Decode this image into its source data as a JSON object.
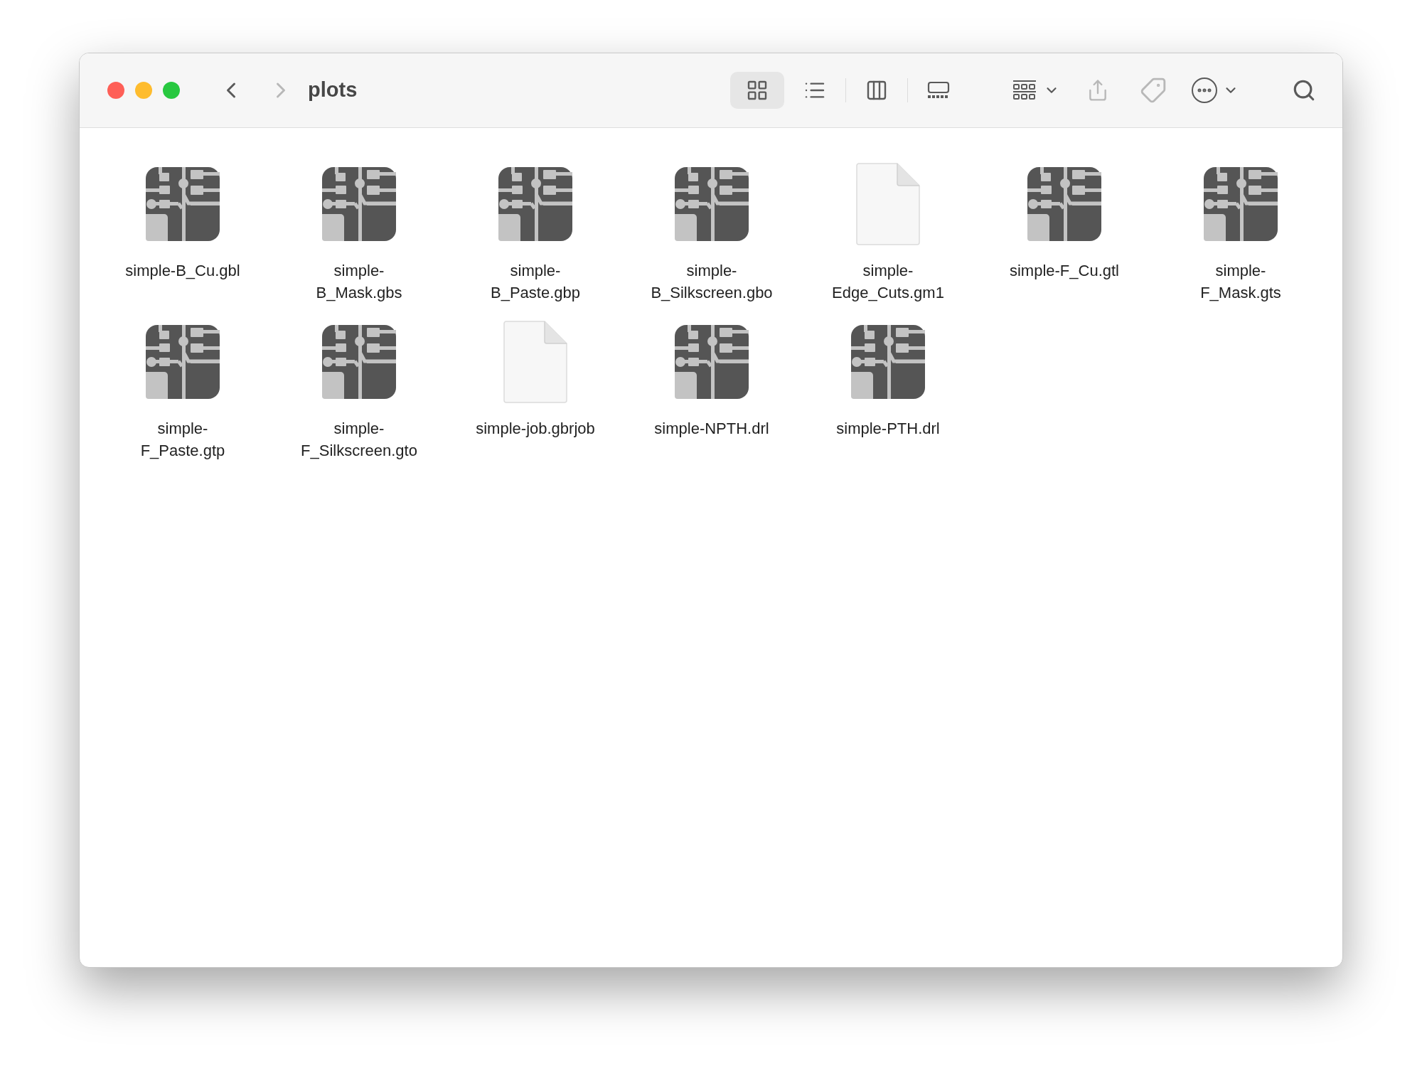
{
  "window": {
    "title": "plots"
  },
  "navigation": [
    {
      "kind": "back",
      "disabled": false
    },
    {
      "kind": "forward",
      "disabled": true
    }
  ],
  "view_buttons": [
    {
      "kind": "icons",
      "selected": true
    },
    {
      "kind": "list",
      "selected": false
    },
    {
      "kind": "columns",
      "selected": false
    },
    {
      "kind": "gallery",
      "selected": false
    }
  ],
  "toolbar_actions": [
    {
      "kind": "group",
      "disabled": false
    },
    {
      "kind": "share",
      "disabled": true
    },
    {
      "kind": "tag",
      "disabled": true
    },
    {
      "kind": "more",
      "disabled": false
    },
    {
      "kind": "search",
      "disabled": false
    }
  ],
  "files": [
    {
      "kind": "pcb",
      "name_lines": [
        "simple-B_Cu.gbl"
      ]
    },
    {
      "kind": "pcb",
      "name_lines": [
        "simple-",
        "B_Mask.gbs"
      ]
    },
    {
      "kind": "pcb",
      "name_lines": [
        "simple-",
        "B_Paste.gbp"
      ]
    },
    {
      "kind": "pcb",
      "name_lines": [
        "simple-",
        "B_Silkscreen.gbo"
      ]
    },
    {
      "kind": "document",
      "name_lines": [
        "simple-",
        "Edge_Cuts.gm1"
      ]
    },
    {
      "kind": "pcb",
      "name_lines": [
        "simple-F_Cu.gtl"
      ]
    },
    {
      "kind": "pcb",
      "name_lines": [
        "simple-",
        "F_Mask.gts"
      ]
    },
    {
      "kind": "pcb",
      "name_lines": [
        "simple-",
        "F_Paste.gtp"
      ]
    },
    {
      "kind": "pcb",
      "name_lines": [
        "simple-",
        "F_Silkscreen.gto"
      ]
    },
    {
      "kind": "document",
      "name_lines": [
        "simple-job.gbrjob"
      ]
    },
    {
      "kind": "pcb",
      "name_lines": [
        "simple-NPTH.drl"
      ]
    },
    {
      "kind": "pcb",
      "name_lines": [
        "simple-PTH.drl"
      ]
    }
  ]
}
